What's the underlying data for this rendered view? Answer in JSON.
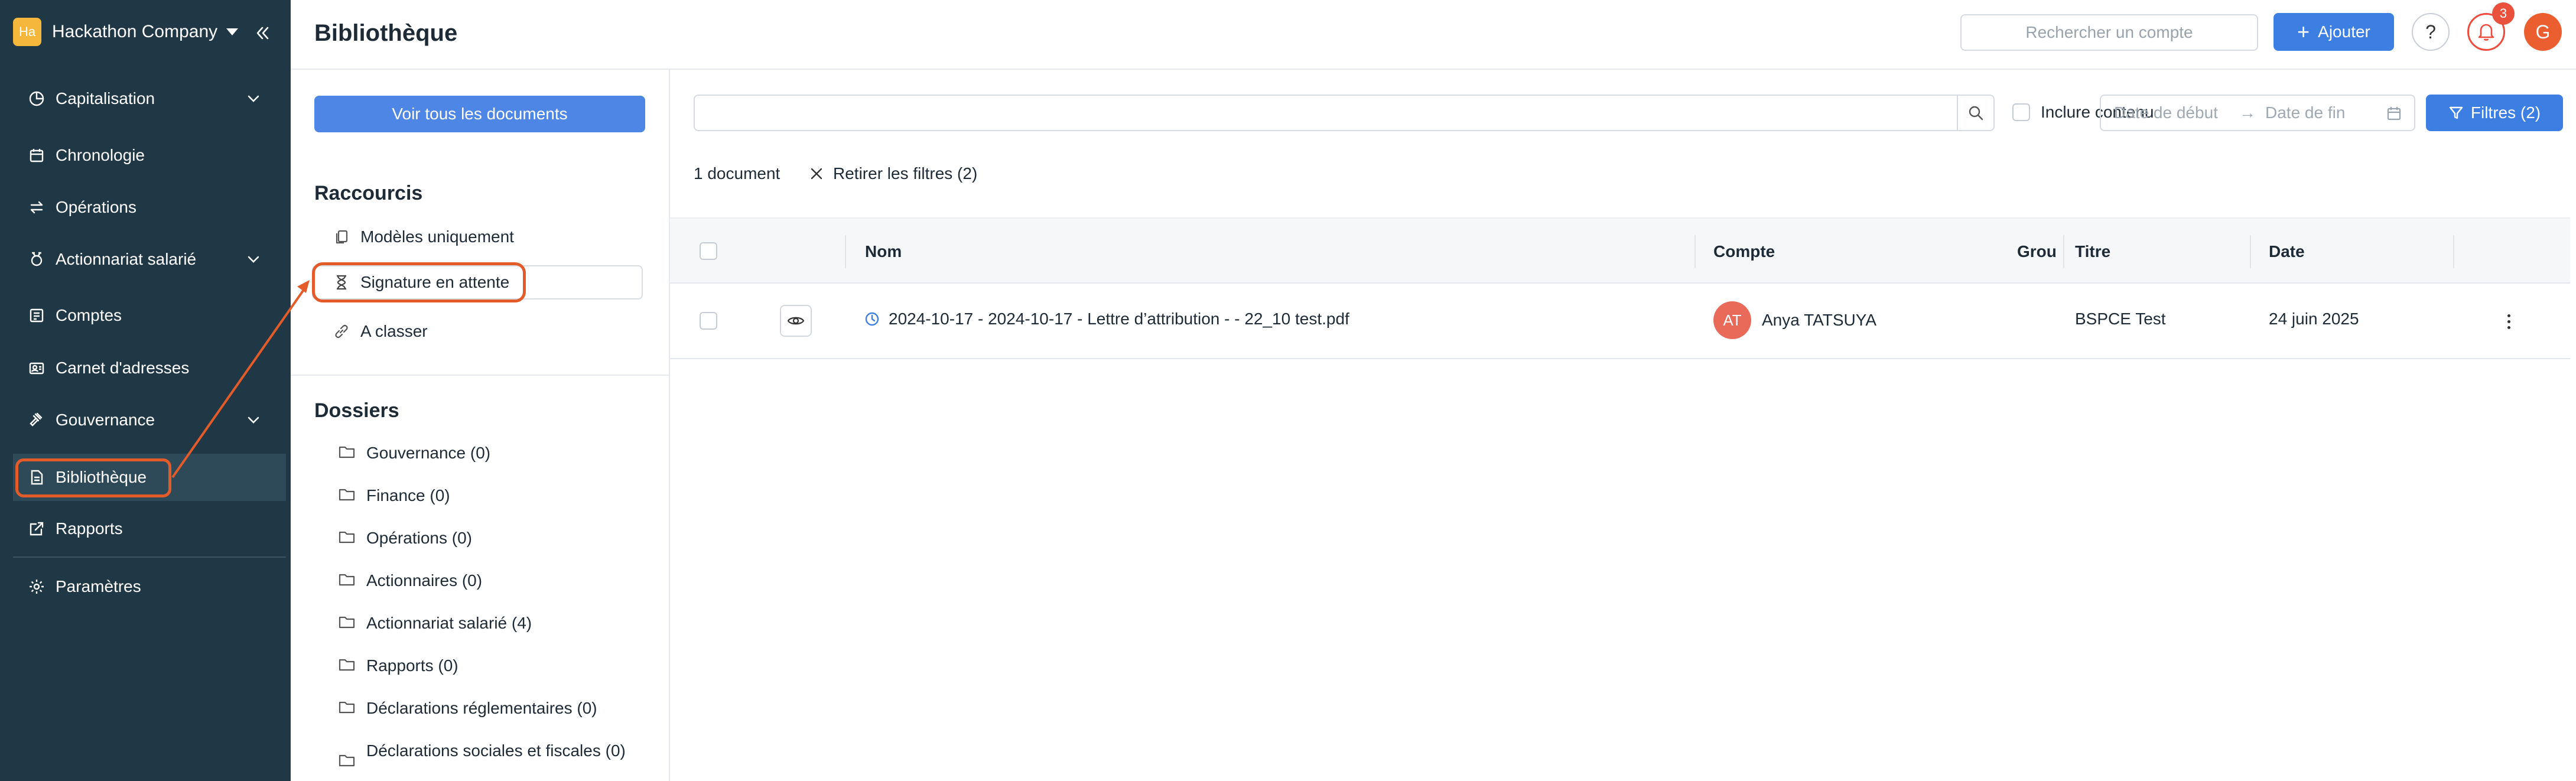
{
  "sidebar": {
    "company": {
      "logo_text": "Ha",
      "name": "Hackathon Company"
    },
    "items": [
      {
        "label": "Capitalisation",
        "icon": "pie-chart-icon",
        "expandable": true
      },
      {
        "label": "Chronologie",
        "icon": "calendar-icon",
        "expandable": false
      },
      {
        "label": "Opérations",
        "icon": "arrows-swap-icon",
        "expandable": false
      },
      {
        "label": "Actionnariat salarié",
        "icon": "badge-icon",
        "expandable": true
      },
      {
        "label": "Comptes",
        "icon": "ledger-icon",
        "expandable": false
      },
      {
        "label": "Carnet d'adresses",
        "icon": "address-card-icon",
        "expandable": false
      },
      {
        "label": "Gouvernance",
        "icon": "gavel-icon",
        "expandable": true
      },
      {
        "label": "Bibliothèque",
        "icon": "document-icon",
        "expandable": false,
        "active": true
      },
      {
        "label": "Rapports",
        "icon": "external-report-icon",
        "expandable": false
      },
      {
        "label": "Paramètres",
        "icon": "gear-icon",
        "expandable": false
      }
    ]
  },
  "header": {
    "title": "Bibliothèque",
    "account_search_placeholder": "Rechercher un compte",
    "add_label": "Ajouter",
    "help_label": "?",
    "notifications_count": "3",
    "user_initial": "G"
  },
  "library": {
    "all_docs_label": "Voir tous les documents",
    "shortcuts_title": "Raccourcis",
    "shortcuts": [
      {
        "label": "Modèles uniquement",
        "icon": "copy-icon"
      },
      {
        "label": "Signature en attente",
        "icon": "hourglass-icon",
        "selected": true
      },
      {
        "label": "A classer",
        "icon": "link-icon"
      }
    ],
    "folders_title": "Dossiers",
    "folders": [
      {
        "label": "Gouvernance (0)"
      },
      {
        "label": "Finance (0)"
      },
      {
        "label": "Opérations (0)"
      },
      {
        "label": "Actionnaires (0)"
      },
      {
        "label": "Actionnariat salarié (4)"
      },
      {
        "label": "Rapports (0)"
      },
      {
        "label": "Déclarations réglementaires (0)"
      },
      {
        "label": "Déclarations sociales et fiscales (0)"
      }
    ]
  },
  "documents": {
    "search_value": "",
    "include_content_label": "Inclure contenu",
    "date_start_placeholder": "Date de début",
    "date_end_placeholder": "Date de fin",
    "date_arrow": "→",
    "filters_label": "Filtres (2)",
    "count_label": "1 document",
    "clear_filters_label": "Retirer les filtres (2)",
    "columns": {
      "name": "Nom",
      "account": "Compte",
      "group": "Grou",
      "title": "Titre",
      "date": "Date"
    },
    "rows": [
      {
        "name": "2024-10-17 - 2024-10-17 - Lettre d’attribution - - 22_10 test.pdf",
        "account_initials": "AT",
        "account": "Anya TATSUYA",
        "group": "",
        "title": "BSPCE Test",
        "date": "24 juin 2025"
      }
    ]
  },
  "colors": {
    "sidebar_bg": "#203846",
    "sidebar_active_bg": "#2e4a58",
    "primary": "#3d7ee3",
    "highlight_annotation": "#e45b2a",
    "notification": "#e9513d",
    "avatar_user": "#ea5e2f",
    "avatar_account": "#ea6a5a",
    "company_logo": "#f5b83d"
  }
}
